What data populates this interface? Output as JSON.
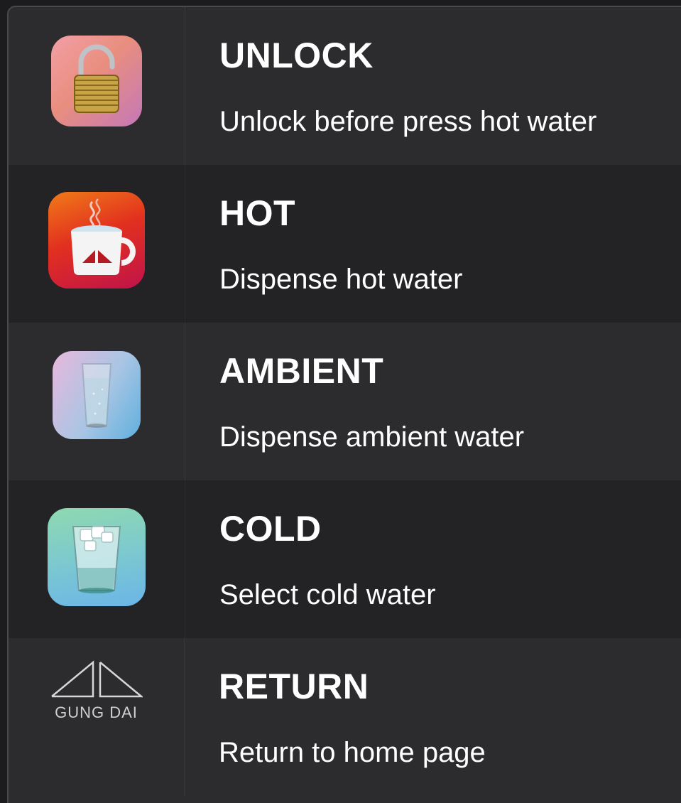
{
  "items": [
    {
      "title": "UNLOCK",
      "subtitle": "Unlock before press hot water",
      "icon": "padlock-icon"
    },
    {
      "title": "HOT",
      "subtitle": "Dispense hot water",
      "icon": "hot-cup-icon"
    },
    {
      "title": "AMBIENT",
      "subtitle": "Dispense ambient water",
      "icon": "water-glass-icon"
    },
    {
      "title": "COLD",
      "subtitle": "Select cold water",
      "icon": "ice-glass-icon"
    },
    {
      "title": "RETURN",
      "subtitle": "Return to home page",
      "icon": "gung-dai-logo"
    }
  ],
  "brand": {
    "name": "GUNG DAI"
  },
  "colors": {
    "background": "#2c2b2e",
    "row_alt": "#232225",
    "text": "#ffffff"
  }
}
